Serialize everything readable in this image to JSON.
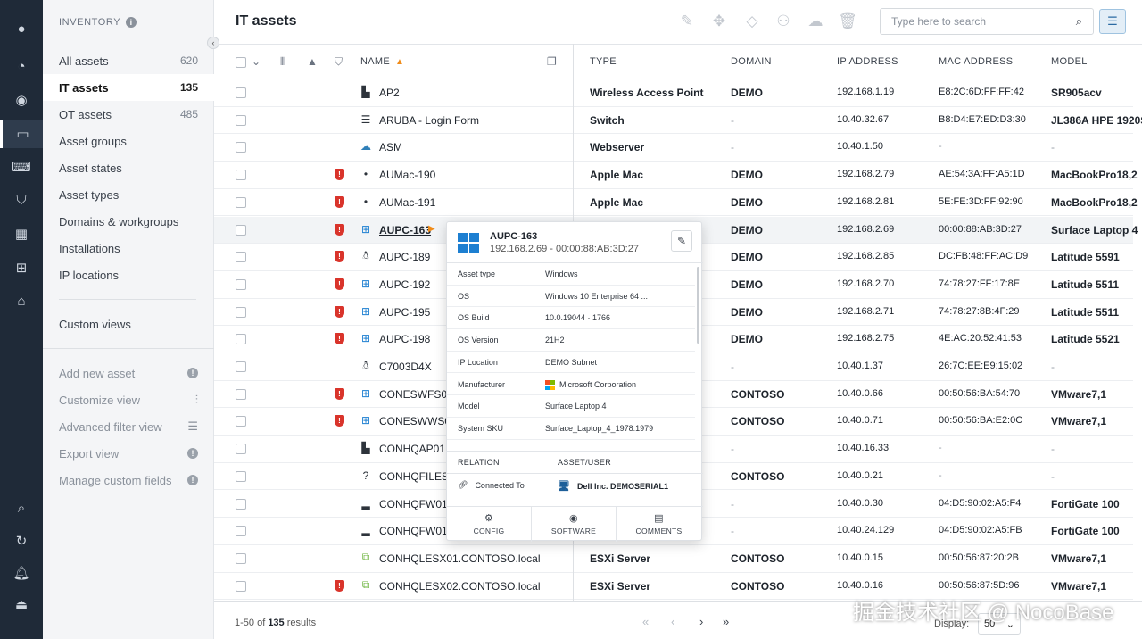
{
  "colors": {
    "accent": "#f08c1a",
    "rail_bg": "#1f2a38",
    "danger": "#d9342b",
    "windows_blue": "#1d7fd1"
  },
  "rail": {
    "icons": [
      "logo-icon",
      "dashboard-icon",
      "scan-icon",
      "inventory-icon",
      "code-icon",
      "shield-icon",
      "reports-icon",
      "network-icon",
      "store-icon",
      "search-icon",
      "refresh-icon",
      "notification-icon",
      "logout-icon"
    ]
  },
  "sidebar": {
    "header": "INVENTORY",
    "items": [
      {
        "label": "All assets",
        "count": "620"
      },
      {
        "label": "IT assets",
        "count": "135"
      },
      {
        "label": "OT assets",
        "count": "485"
      },
      {
        "label": "Asset groups"
      },
      {
        "label": "Asset states"
      },
      {
        "label": "Asset types"
      },
      {
        "label": "Domains & workgroups"
      },
      {
        "label": "Installations"
      },
      {
        "label": "IP locations"
      }
    ],
    "custom_views": "Custom views",
    "actions": [
      {
        "label": "Add new asset",
        "icon": "info-icon"
      },
      {
        "label": "Customize view",
        "icon": "sliders-icon"
      },
      {
        "label": "Advanced filter view",
        "icon": "filter-icon"
      },
      {
        "label": "Export view",
        "icon": "info-icon"
      },
      {
        "label": "Manage custom fields",
        "icon": "info-icon"
      }
    ]
  },
  "header": {
    "title": "IT assets",
    "search_placeholder": "Type here to search"
  },
  "table": {
    "columns": {
      "name": "NAME",
      "type": "TYPE",
      "domain": "DOMAIN",
      "ip": "IP ADDRESS",
      "mac": "MAC ADDRESS",
      "model": "MODEL"
    },
    "rows": [
      {
        "name": "AP2",
        "type": "Wireless Access Point",
        "domain": "DEMO",
        "ip": "192.168.1.19",
        "mac": "E8:2C:6D:FF:FF:42",
        "model": "SR905acv",
        "os": "ap",
        "alert": false
      },
      {
        "name": "ARUBA - Login Form",
        "type": "Switch",
        "domain": "-",
        "ip": "10.40.32.67",
        "mac": "B8:D4:E7:ED:D3:30",
        "model": "JL386A HPE 1920S",
        "os": "switch",
        "alert": false
      },
      {
        "name": "ASM",
        "type": "Webserver",
        "domain": "-",
        "ip": "10.40.1.50",
        "mac": "-",
        "model": "-",
        "os": "web",
        "alert": false
      },
      {
        "name": "AUMac-190",
        "type": "Apple Mac",
        "domain": "DEMO",
        "ip": "192.168.2.79",
        "mac": "AE:54:3A:FF:A5:1D",
        "model": "MacBookPro18,2",
        "os": "apple",
        "alert": true
      },
      {
        "name": "AUMac-191",
        "type": "Apple Mac",
        "domain": "DEMO",
        "ip": "192.168.2.81",
        "mac": "5E:FE:3D:FF:92:90",
        "model": "MacBookPro18,2",
        "os": "apple",
        "alert": true
      },
      {
        "name": "AUPC-163",
        "type": "",
        "domain": "DEMO",
        "ip": "192.168.2.69",
        "mac": "00:00:88:AB:3D:27",
        "model": "Surface Laptop 4",
        "os": "win",
        "alert": true
      },
      {
        "name": "AUPC-189",
        "type": "",
        "domain": "DEMO",
        "ip": "192.168.2.85",
        "mac": "DC:FB:48:FF:AC:D9",
        "model": "Latitude 5591",
        "os": "linux",
        "alert": true
      },
      {
        "name": "AUPC-192",
        "type": "",
        "domain": "DEMO",
        "ip": "192.168.2.70",
        "mac": "74:78:27:FF:17:8E",
        "model": "Latitude 5511",
        "os": "win",
        "alert": true
      },
      {
        "name": "AUPC-195",
        "type": "",
        "domain": "DEMO",
        "ip": "192.168.2.71",
        "mac": "74:78:27:8B:4F:29",
        "model": "Latitude 5511",
        "os": "win",
        "alert": true
      },
      {
        "name": "AUPC-198",
        "type": "",
        "domain": "DEMO",
        "ip": "192.168.2.75",
        "mac": "4E:AC:20:52:41:53",
        "model": "Latitude 5521",
        "os": "win",
        "alert": true
      },
      {
        "name": "C7003D4X",
        "type": "",
        "domain": "-",
        "ip": "10.40.1.37",
        "mac": "26:7C:EE:E9:15:02",
        "model": "-",
        "os": "linux",
        "alert": false
      },
      {
        "name": "CONESWFS01",
        "type": "",
        "domain": "CONTOSO",
        "ip": "10.40.0.66",
        "mac": "00:50:56:BA:54:70",
        "model": "VMware7,1",
        "os": "win",
        "alert": true
      },
      {
        "name": "CONESWWS01",
        "type": "",
        "domain": "CONTOSO",
        "ip": "10.40.0.71",
        "mac": "00:50:56:BA:E2:0C",
        "model": "VMware7,1",
        "os": "win",
        "alert": true
      },
      {
        "name": "CONHQAP01",
        "type": "",
        "domain": "-",
        "ip": "10.40.16.33",
        "mac": "-",
        "model": "-",
        "os": "ap",
        "alert": false
      },
      {
        "name": "CONHQFILES01",
        "type": "",
        "domain": "CONTOSO",
        "ip": "10.40.0.21",
        "mac": "-",
        "model": "-",
        "os": "unknown",
        "alert": false
      },
      {
        "name": "CONHQFW01.co",
        "type": "",
        "domain": "-",
        "ip": "10.40.0.30",
        "mac": "04:D5:90:02:A5:F4",
        "model": "FortiGate 100",
        "os": "printer",
        "alert": false
      },
      {
        "name": "CONHQFW01.co",
        "type": "",
        "domain": "-",
        "ip": "10.40.24.129",
        "mac": "04:D5:90:02:A5:FB",
        "model": "FortiGate 100",
        "os": "printer",
        "alert": false
      },
      {
        "name": "CONHQLESX01.CONTOSO.local",
        "type": "ESXi Server",
        "domain": "CONTOSO",
        "ip": "10.40.0.15",
        "mac": "00:50:56:87:20:2B",
        "model": "VMware7,1",
        "os": "esx",
        "alert": false
      },
      {
        "name": "CONHQLESX02.CONTOSO.local",
        "type": "ESXi Server",
        "domain": "CONTOSO",
        "ip": "10.40.0.16",
        "mac": "00:50:56:87:5D:96",
        "model": "VMware7,1",
        "os": "esx",
        "alert": true
      }
    ]
  },
  "popover": {
    "title": "AUPC-163",
    "subtitle": "192.168.2.69 - 00:00:88:AB:3D:27",
    "fields": [
      {
        "key": "Asset type",
        "value": "Windows"
      },
      {
        "key": "OS",
        "value": "Windows 10 Enterprise 64 ..."
      },
      {
        "key": "OS Build",
        "value": "10.0.19044 · 1766"
      },
      {
        "key": "OS Version",
        "value": "21H2"
      },
      {
        "key": "IP Location",
        "value": "DEMO Subnet"
      },
      {
        "key": "Manufacturer",
        "value": "Microsoft Corporation"
      },
      {
        "key": "Model",
        "value": "Surface Laptop 4"
      },
      {
        "key": "System SKU",
        "value": "Surface_Laptop_4_1978:1979"
      }
    ],
    "relation_header": "RELATION",
    "asset_user_header": "ASSET/USER",
    "relation": "Connected To",
    "related_asset": "Dell Inc. DEMOSERIAL1",
    "tabs": [
      "CONFIG",
      "SOFTWARE",
      "COMMENTS"
    ]
  },
  "footer": {
    "range": "1-50 of",
    "total": "135",
    "results_word": "results",
    "display_label": "Display:",
    "page_size": "50"
  },
  "watermark": "掘金技术社区 @ NocoBase"
}
